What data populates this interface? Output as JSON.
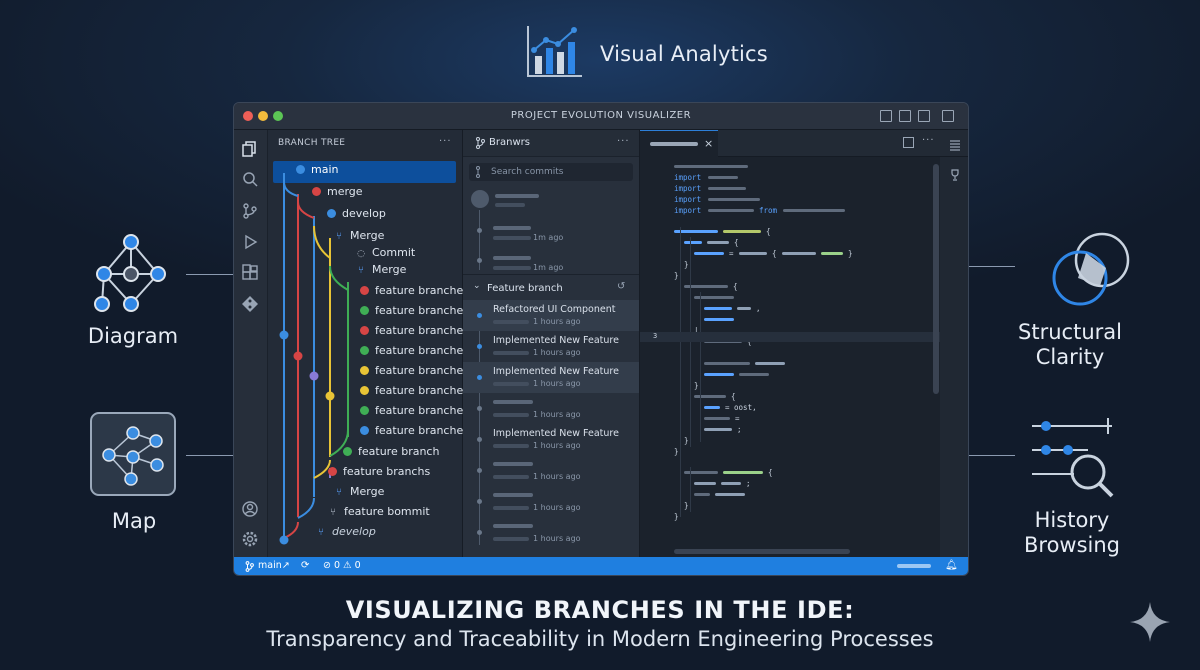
{
  "header": {
    "title": "Visual Analytics",
    "icon": "bar-chart-icon"
  },
  "features": {
    "left": [
      {
        "label": "Diagram",
        "icon": "network-diagram-icon"
      },
      {
        "label": "Map",
        "icon": "map-graph-icon"
      }
    ],
    "right": [
      {
        "label": "Structural Clarity",
        "icon": "overlapping-shapes-icon"
      },
      {
        "label": "History Browsing",
        "icon": "timeline-search-icon"
      }
    ]
  },
  "window": {
    "title": "PROJECT EVOLUTION VISUALIZER",
    "branch_tree": {
      "header": "BRANCH TREE",
      "rows": [
        {
          "label": "main"
        },
        {
          "label": "merge"
        },
        {
          "label": "develop"
        },
        {
          "label": "Merge"
        },
        {
          "label": "Commit"
        },
        {
          "label": "Merge"
        },
        {
          "label": "feature branche..."
        },
        {
          "label": "feature branche..."
        },
        {
          "label": "feature branche..."
        },
        {
          "label": "feature branche..."
        },
        {
          "label": "feature branche..."
        },
        {
          "label": "feature branche..."
        },
        {
          "label": "feature branche..."
        },
        {
          "label": "feature branche..."
        },
        {
          "label": "feature branch"
        },
        {
          "label": "feature branchs"
        },
        {
          "label": "Merge"
        },
        {
          "label": "feature bommit"
        },
        {
          "label": "develop"
        }
      ]
    },
    "commit_panel": {
      "tab_label": "Branwrs",
      "search_placeholder": "Search commits",
      "top_commits": [
        {
          "meta": "1m ago"
        },
        {
          "meta": "1m ago"
        }
      ],
      "section_title": "Feature branch",
      "commits": [
        {
          "title": "Refactored UI Component",
          "meta": "1 hours ago"
        },
        {
          "title": "Implemented New Feature",
          "meta": "1 hours ago"
        },
        {
          "title": "Implemented New Feature",
          "meta": "1 hours ago"
        },
        {
          "title": "",
          "meta": "1 hours ago"
        },
        {
          "title": "Implemented New Feature",
          "meta": "1 hours ago"
        },
        {
          "title": "",
          "meta": "1 hours ago"
        },
        {
          "title": "",
          "meta": "1 hours ago"
        },
        {
          "title": "",
          "meta": "1 hours ago"
        }
      ]
    },
    "editor": {
      "keywords": [
        "import",
        "import",
        "import",
        "import"
      ],
      "from_keyword": "from",
      "line_number": "3",
      "snippet_assign": "= oost,"
    },
    "status_bar": {
      "branch": "main↗",
      "problems": "⊘ 0 ⚠ 0"
    }
  },
  "footer": {
    "title": "VISUALIZING BRANCHES IN THE IDE:",
    "subtitle": "Transparency and Traceability in Modern Engineering Processes"
  },
  "colors": {
    "accent": "#1f7fe0",
    "branch_blue": "#3b8de0",
    "branch_red": "#d64545",
    "branch_yellow": "#e8c436",
    "branch_green": "#3fae55",
    "branch_purple": "#8a7bd6"
  }
}
